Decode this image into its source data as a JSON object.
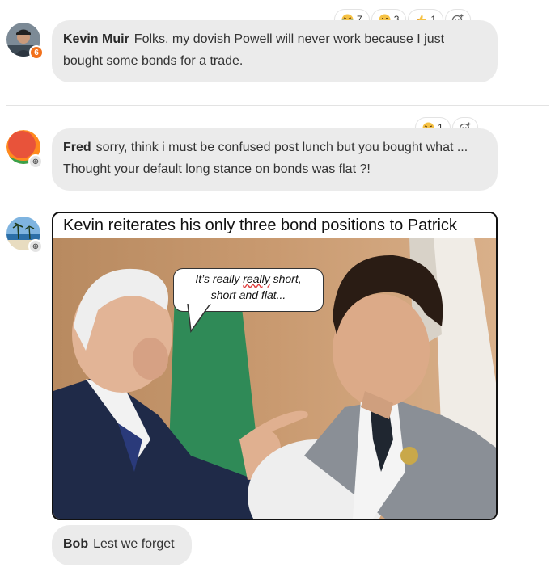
{
  "comments": [
    {
      "author": "Kevin Muir",
      "text": "Folks, my dovish Powell will never work because I just bought some bonds for a trade.",
      "avatar_badge": "6",
      "reactions": [
        {
          "icon": "laugh-emoji-icon",
          "count": "7"
        },
        {
          "icon": "surprised-emoji-icon",
          "count": "3"
        },
        {
          "icon": "thumbs-up-icon",
          "count": "1"
        }
      ]
    },
    {
      "author": "Fred",
      "text": "sorry, think i must be confused post lunch but you bought what ... Thought your default long stance on bonds was flat ?!",
      "reactions": [
        {
          "icon": "laugh-emoji-icon",
          "count": "1"
        }
      ]
    },
    {
      "meme_title": "Kevin reiterates his only three bond positions to Patrick",
      "speech_before": "It’s really ",
      "speech_underlined": "really",
      "speech_mid": " short,",
      "speech_line2": "short and flat..."
    },
    {
      "author": "Bob",
      "text": "Lest we forget"
    }
  ],
  "colors": {
    "bubble_bg": "#ebebeb",
    "badge_orange": "#f2711c",
    "divider": "#e3e3e3"
  }
}
